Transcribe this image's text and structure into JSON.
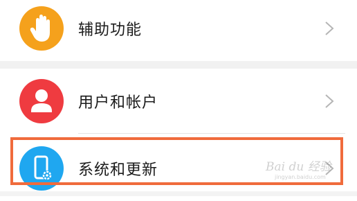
{
  "settings_items": [
    {
      "label": "辅助功能",
      "icon": "hand-icon",
      "icon_color": "#f5a11c"
    },
    {
      "label": "用户和帐户",
      "icon": "user-icon",
      "icon_color": "#ef3b40"
    },
    {
      "label": "系统和更新",
      "icon": "phone-settings-icon",
      "icon_color": "#1fa7f0"
    }
  ],
  "highlight_color": "#f06b3c",
  "watermark": "Bai du 经验",
  "watermark_sub": "jingyan.baidu.com"
}
